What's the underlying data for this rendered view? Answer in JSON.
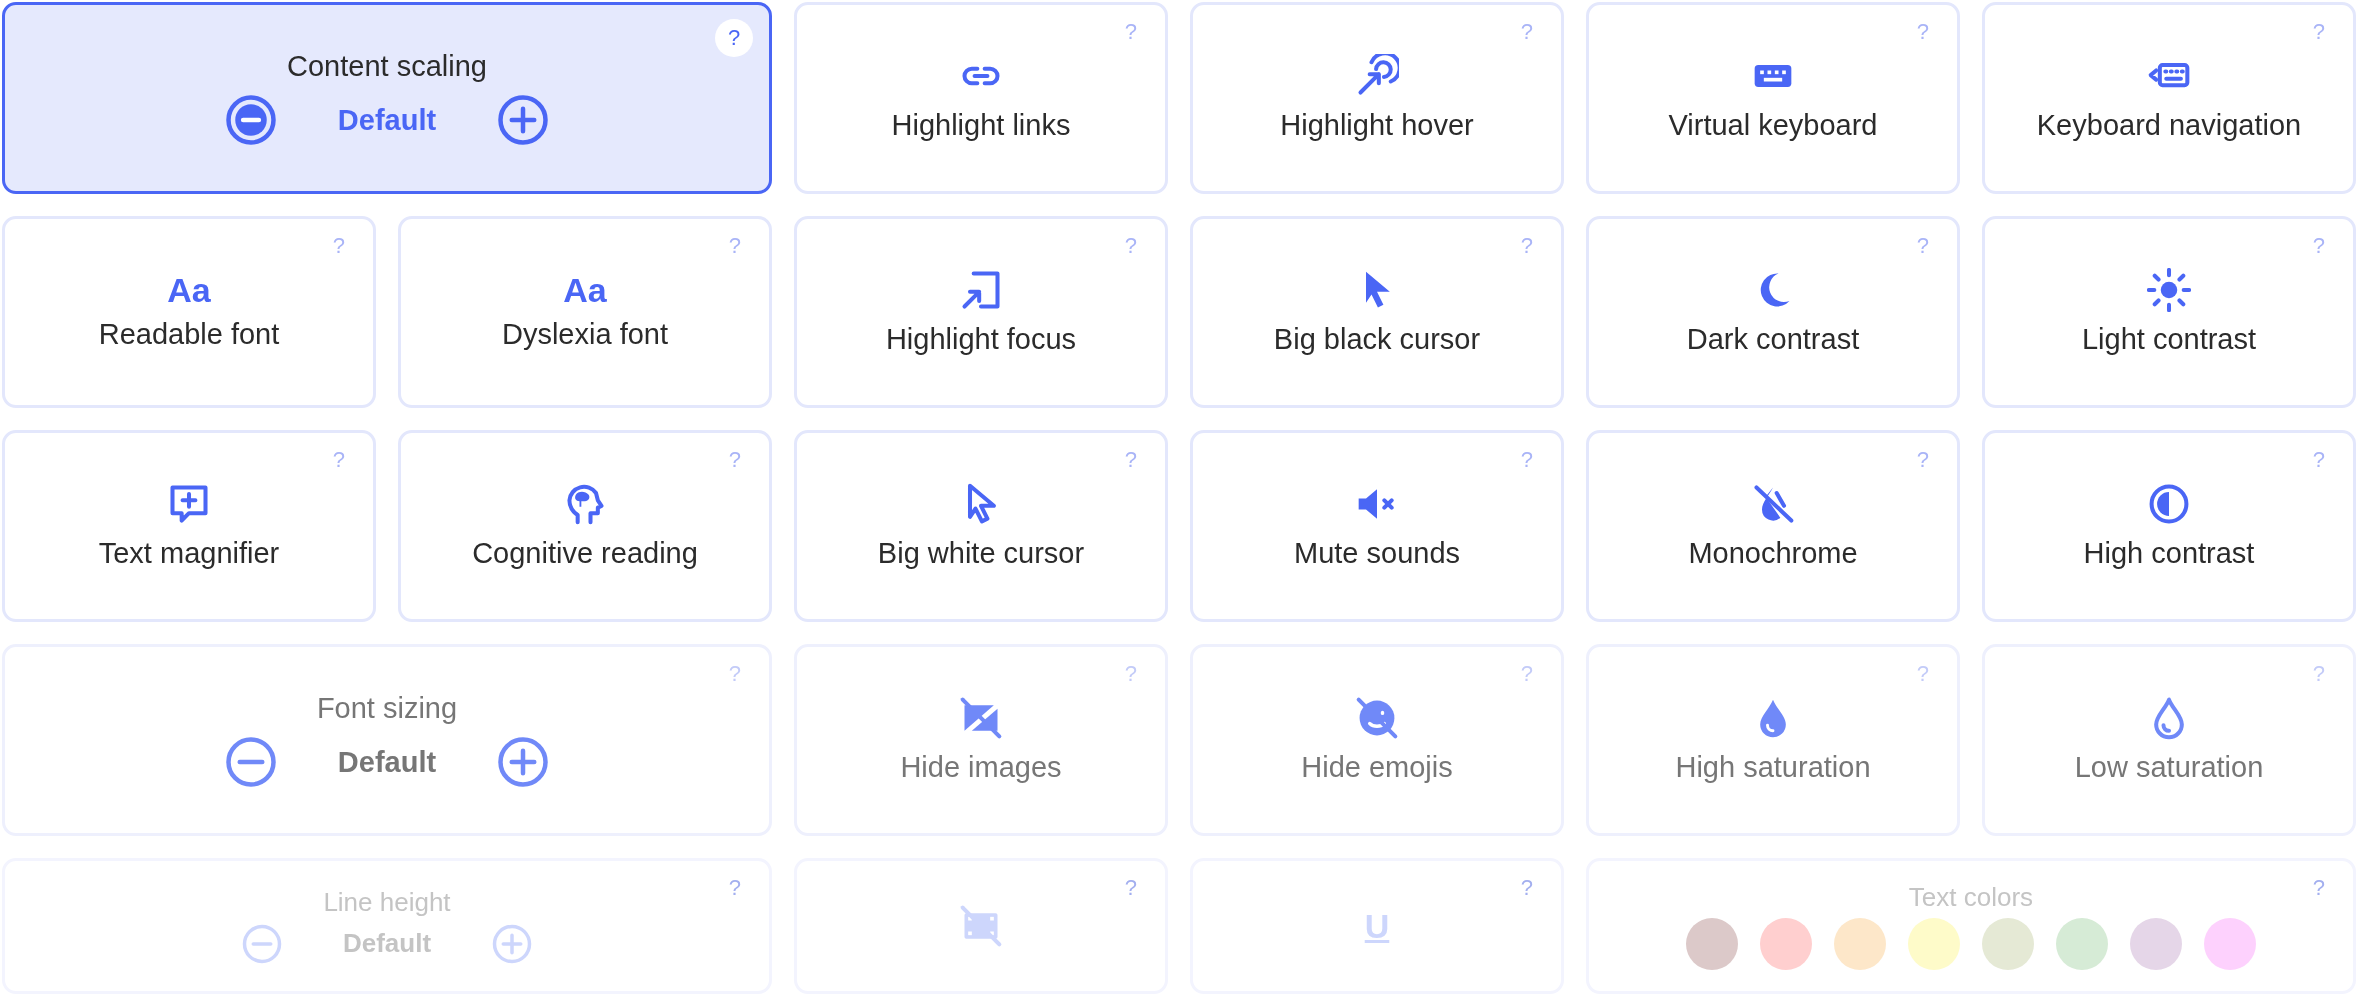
{
  "cards": [
    {
      "kind": "stepper",
      "title": "Content scaling",
      "value": "Default",
      "help": "?",
      "selected": true
    },
    {
      "kind": "toggle",
      "label": "Highlight links",
      "help": "?",
      "selected": false
    },
    {
      "kind": "toggle",
      "label": "Highlight hover",
      "help": "?",
      "selected": false
    },
    {
      "kind": "toggle",
      "label": "Virtual keyboard",
      "help": "?",
      "selected": false
    },
    {
      "kind": "toggle",
      "label": "Keyboard navigation",
      "help": "?",
      "selected": false
    },
    {
      "kind": "toggle",
      "glyph": "Aa",
      "label": "Readable font",
      "help": "?",
      "selected": false
    },
    {
      "kind": "toggle",
      "glyph": "Aa",
      "label": "Dyslexia font",
      "help": "?",
      "selected": false
    },
    {
      "kind": "toggle",
      "label": "Highlight focus",
      "help": "?",
      "selected": false
    },
    {
      "kind": "toggle",
      "label": "Big black cursor",
      "help": "?",
      "selected": false
    },
    {
      "kind": "toggle",
      "label": "Dark contrast",
      "help": "?",
      "selected": false
    },
    {
      "kind": "toggle",
      "label": "Light contrast",
      "help": "?",
      "selected": false
    },
    {
      "kind": "toggle",
      "label": "Text magnifier",
      "help": "?",
      "selected": false
    },
    {
      "kind": "toggle",
      "label": "Cognitive reading",
      "help": "?",
      "selected": false
    },
    {
      "kind": "toggle",
      "label": "Big white cursor",
      "help": "?",
      "selected": false
    },
    {
      "kind": "toggle",
      "label": "Mute sounds",
      "help": "?",
      "selected": false
    },
    {
      "kind": "toggle",
      "label": "Monochrome",
      "help": "?",
      "selected": false
    },
    {
      "kind": "toggle",
      "label": "High contrast",
      "help": "?",
      "selected": false
    },
    {
      "kind": "stepper",
      "title": "Font sizing",
      "value": "Default",
      "help": "?",
      "selected": false
    },
    {
      "kind": "toggle",
      "label": "Hide images",
      "help": "?",
      "selected": false
    },
    {
      "kind": "toggle",
      "label": "Hide emojis",
      "help": "?",
      "selected": false
    },
    {
      "kind": "toggle",
      "label": "High saturation",
      "help": "?",
      "selected": false
    },
    {
      "kind": "toggle",
      "label": "Low saturation",
      "help": "?",
      "selected": false
    },
    {
      "kind": "stepper",
      "title": "Line height",
      "value": "Default",
      "help": "?",
      "selected": false
    },
    {
      "kind": "toggle",
      "help": "?",
      "selected": false
    },
    {
      "kind": "toggle",
      "glyph": "U",
      "help": "?",
      "selected": false
    },
    {
      "kind": "palette",
      "title": "Text colors",
      "help": "?",
      "selected": false,
      "colors": [
        {
          "color": "#dcc9c9"
        },
        {
          "color": "#ffcfcf"
        },
        {
          "color": "#fde7c9"
        },
        {
          "color": "#fefbc9"
        },
        {
          "color": "#e5e9d5"
        },
        {
          "color": "#d6ebd6"
        },
        {
          "color": "#e5d6e8"
        },
        {
          "color": "#fdd1fd"
        }
      ]
    }
  ]
}
